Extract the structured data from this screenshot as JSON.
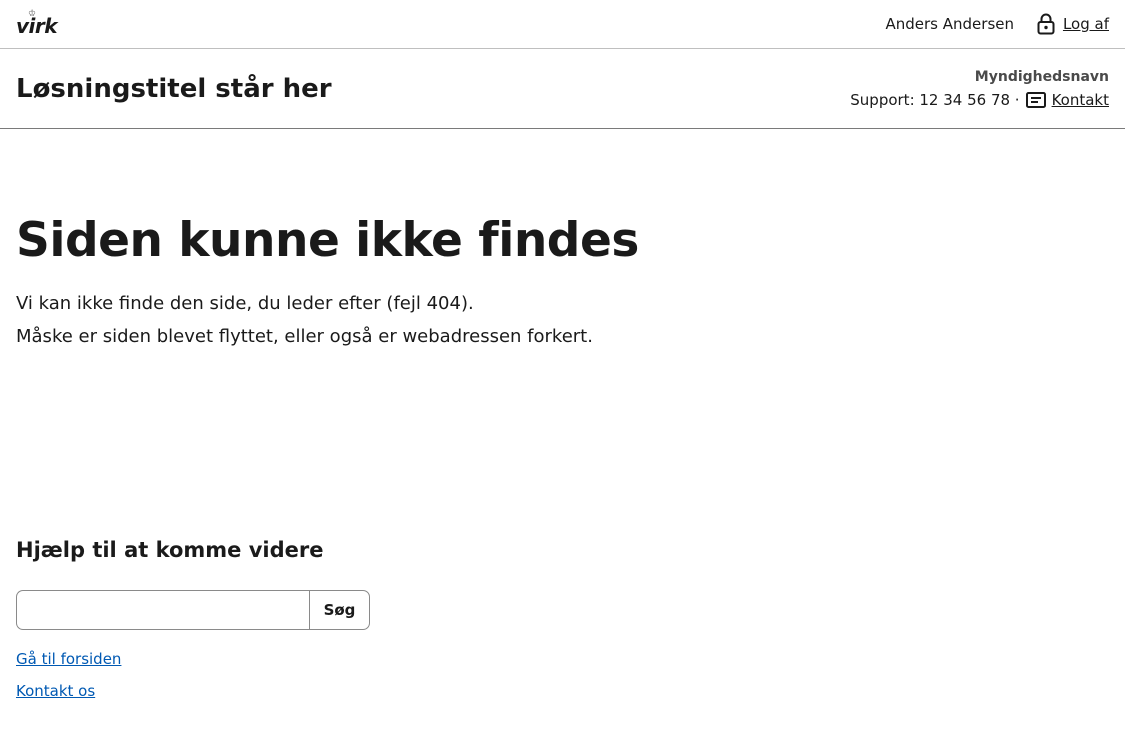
{
  "topbar": {
    "logo_text": "virk",
    "user_name": "Anders Andersen",
    "logout_label": "Log af",
    "logout_icon": "lock-icon"
  },
  "header": {
    "solution_title": "Løsningstitel står her",
    "authority_name": "Myndighedsnavn",
    "support_text": "Support: 12 34 56 78 ·",
    "contact_icon": "message-icon",
    "contact_label": "Kontakt"
  },
  "main": {
    "title": "Siden kunne ikke findes",
    "text_line_1": "Vi kan ikke finde den side, du leder efter (fejl 404).",
    "text_line_2": "Måske er siden blevet flyttet, eller også er webadressen forkert.",
    "help": {
      "heading": "Hjælp til at komme videre",
      "search_value": "",
      "search_placeholder": "",
      "search_button_label": "Søg",
      "links": [
        {
          "label": "Gå til forsiden"
        },
        {
          "label": "Kontakt os"
        }
      ]
    }
  },
  "colors": {
    "link": "#0059b3",
    "text": "#1a1a1a",
    "border": "#8a8a8a"
  }
}
